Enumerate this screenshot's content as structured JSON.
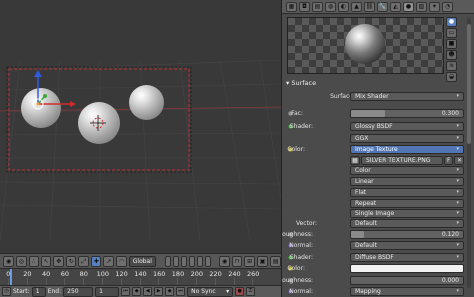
{
  "viewport": {
    "header": {
      "orientation_select": "Global"
    }
  },
  "timeline": {
    "ticks": [
      "0",
      "20",
      "40",
      "60",
      "80",
      "100",
      "120",
      "140",
      "160",
      "180",
      "200",
      "220",
      "240",
      "260"
    ]
  },
  "footer": {
    "start_label": "Start:",
    "start_value": "1",
    "end_label": "End:",
    "end_value": "250",
    "current_frame": "1",
    "sync": "No Sync"
  },
  "properties": {
    "section_title": "Surface",
    "surface": {
      "label": "Surface:",
      "value": "Mix Shader"
    },
    "fac": {
      "label": "Fac:",
      "value": "0.300",
      "fraction": 0.3
    },
    "shader1": {
      "label": "Shader:",
      "value": "Glossy BSDF"
    },
    "distribution": {
      "value": "GGX"
    },
    "color1": {
      "label": "Color:",
      "value": "Image Texture"
    },
    "image_name": "SILVER TEXTURE.PNG",
    "image_flag": "F",
    "color_mode": "Color",
    "interpolation": "Linear",
    "projection": "Flat",
    "extension": "Repeat",
    "source": "Single Image",
    "vector": {
      "label": "Vector:",
      "value": "Default"
    },
    "roughness1": {
      "label": "Roughness:",
      "value": "0.120",
      "fraction": 0.12
    },
    "normal1": {
      "label": "Normal:",
      "value": "Default"
    },
    "shader2": {
      "label": "Shader:",
      "value": "Diffuse BSDF"
    },
    "color2": {
      "label": "Color:"
    },
    "roughness2": {
      "label": "Roughness:",
      "value": "0.000",
      "fraction": 0.0
    },
    "normal2": {
      "label": "Normal:",
      "value": "Mapping"
    }
  },
  "colors": {
    "accent_blue": "#5276b4",
    "border_red": "#c03030"
  }
}
